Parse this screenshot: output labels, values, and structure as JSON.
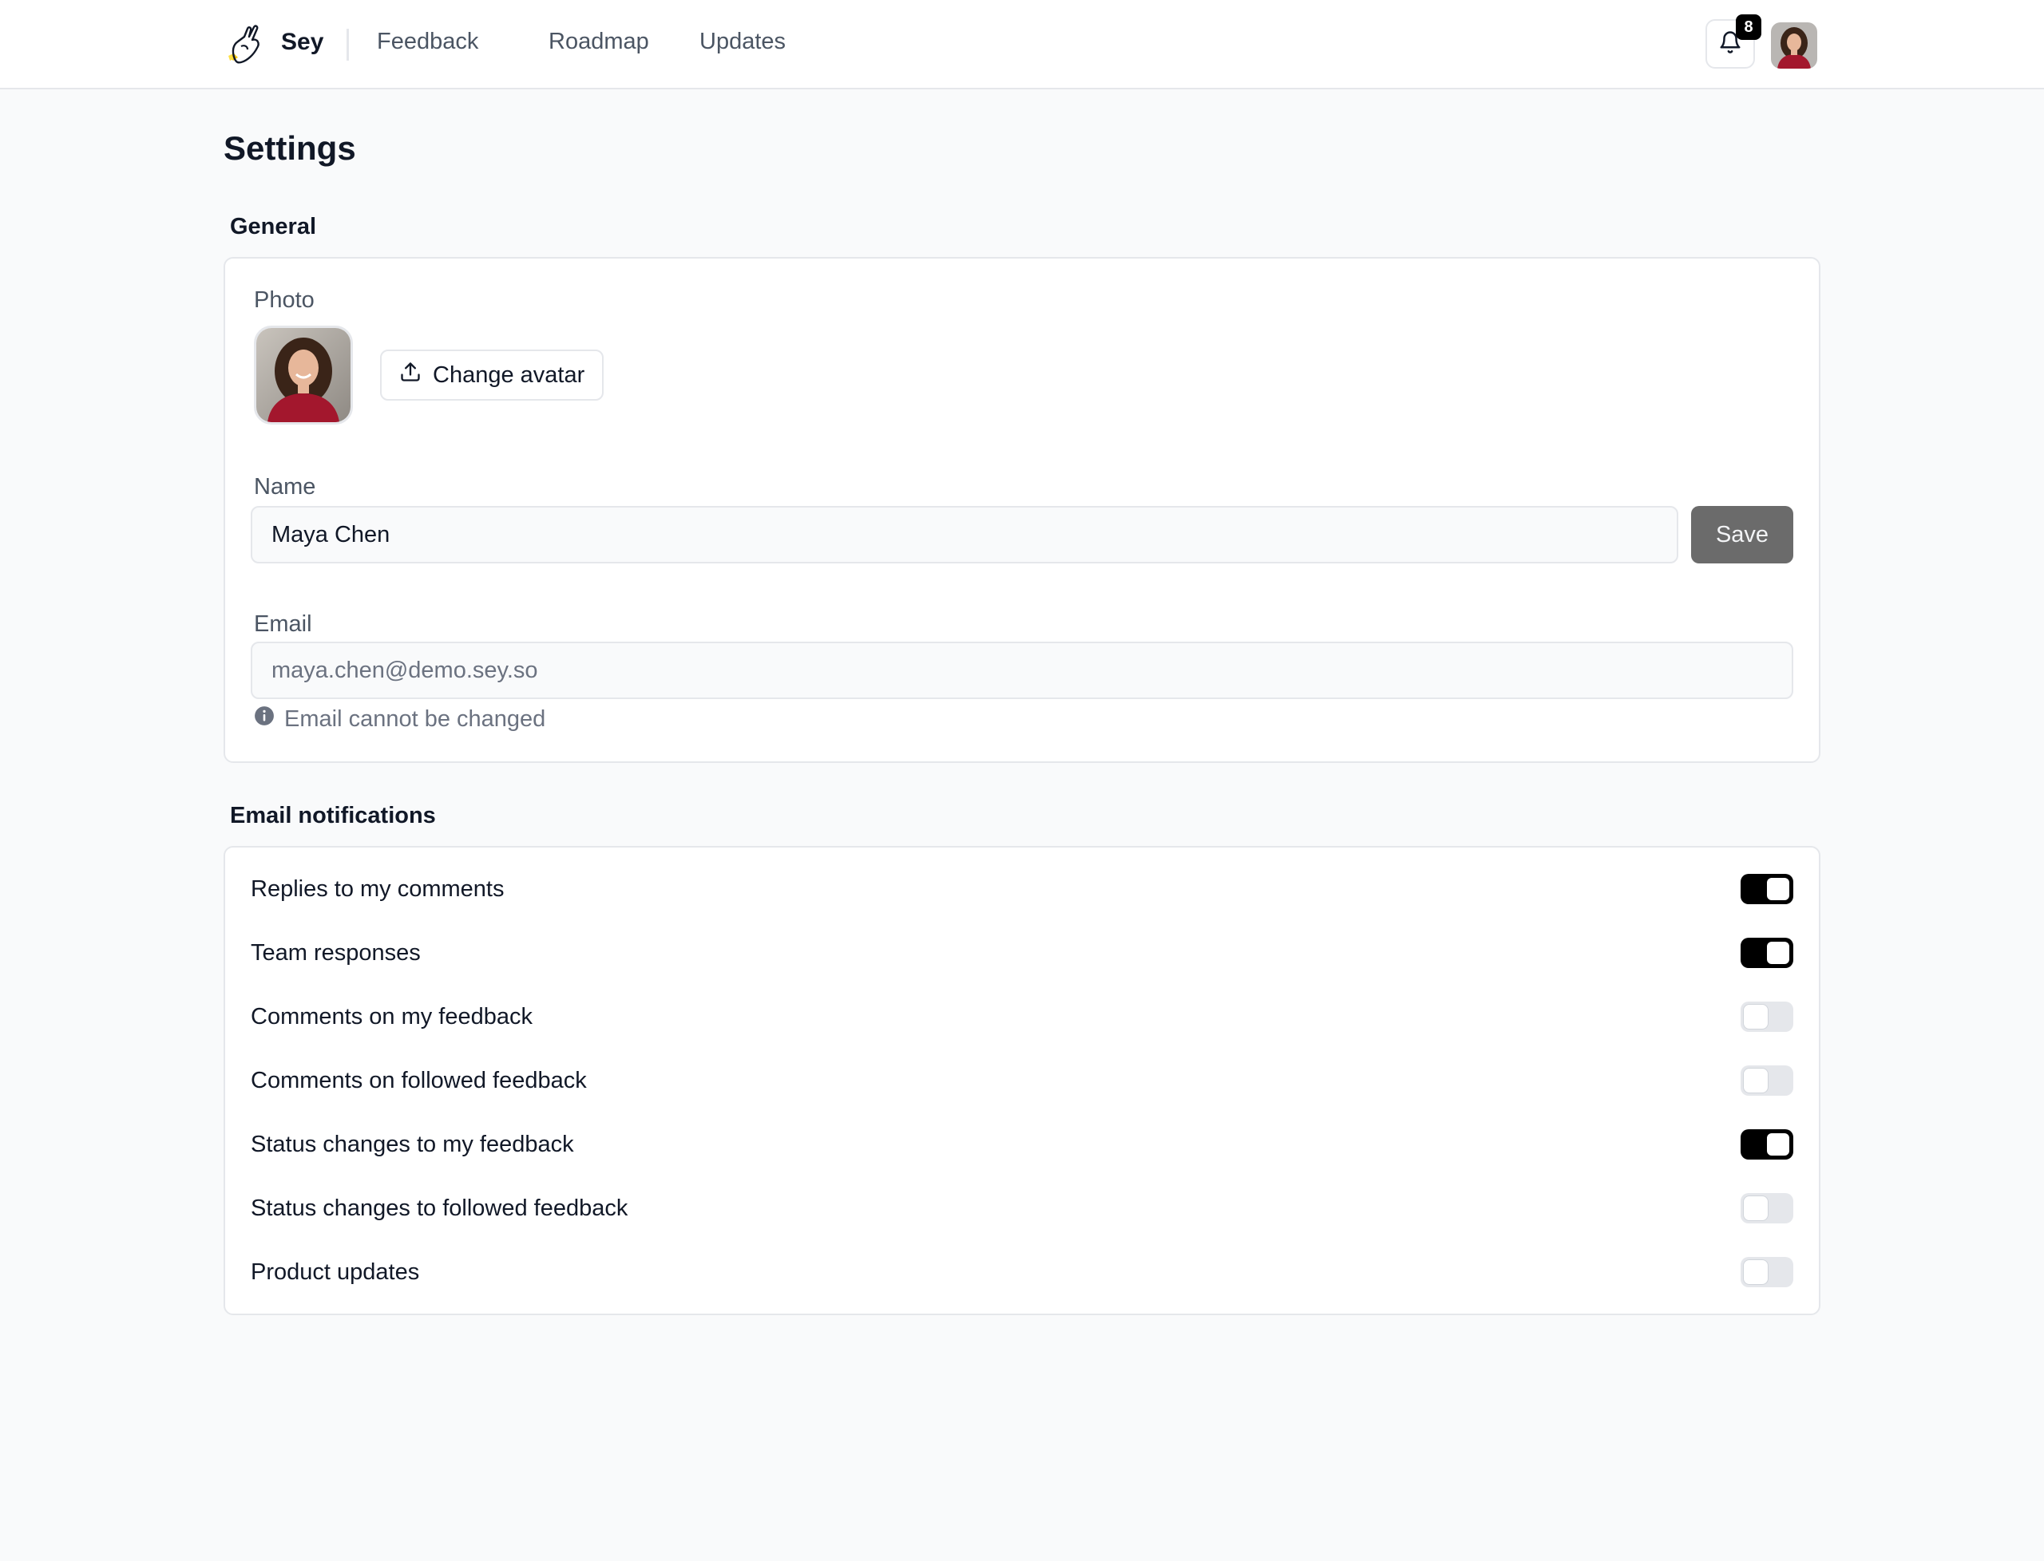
{
  "header": {
    "brand": "Sey",
    "nav": [
      {
        "label": "Feedback"
      },
      {
        "label": "Roadmap"
      },
      {
        "label": "Updates"
      }
    ],
    "notifications_count": "8"
  },
  "page": {
    "title": "Settings"
  },
  "general": {
    "section_title": "General",
    "photo_label": "Photo",
    "change_avatar_label": "Change avatar",
    "name_label": "Name",
    "name_value": "Maya Chen",
    "save_label": "Save",
    "email_label": "Email",
    "email_value": "maya.chen@demo.sey.so",
    "email_hint": "Email cannot be changed"
  },
  "notifications": {
    "section_title": "Email notifications",
    "items": [
      {
        "label": "Replies to my comments",
        "enabled": true
      },
      {
        "label": "Team responses",
        "enabled": true
      },
      {
        "label": "Comments on my feedback",
        "enabled": false
      },
      {
        "label": "Comments on followed feedback",
        "enabled": false
      },
      {
        "label": "Status changes to my feedback",
        "enabled": true
      },
      {
        "label": "Status changes to followed feedback",
        "enabled": false
      },
      {
        "label": "Product updates",
        "enabled": false
      }
    ]
  },
  "colors": {
    "accent": "#000000",
    "toggle_off": "#e5e7eb",
    "save_button": "#6b6b6b",
    "page_background": "#f9fafb"
  },
  "icons": {
    "logo": "hand-sparkle-logo-icon",
    "notifications": "bell-icon",
    "upload": "upload-icon",
    "info": "info-icon"
  }
}
